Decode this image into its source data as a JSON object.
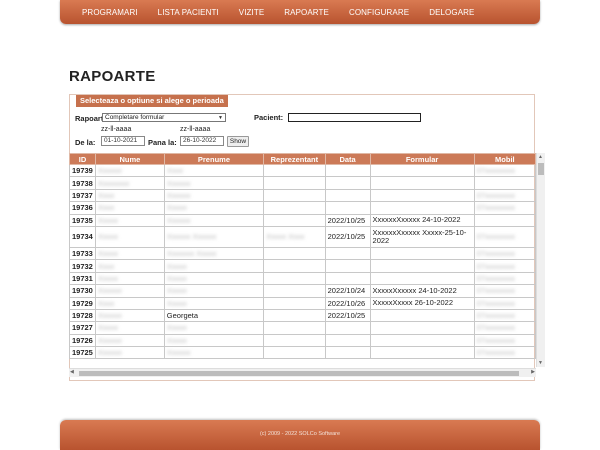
{
  "nav": [
    "PROGRAMARI",
    "LISTA PACIENTI",
    "VIZITE",
    "RAPOARTE",
    "CONFIGURARE",
    "DELOGARE"
  ],
  "page_title": "RAPOARTE",
  "filters": {
    "header": "Selecteaza o optiune si alege o perioada",
    "report_label": "Rapoarte:",
    "report_selected": "Completare formular",
    "patient_label": "Pacient:",
    "patient_value": "",
    "date_hint_from": "zz-ll-aaaa",
    "date_hint_to": "zz-ll-aaaa",
    "from_label": "De la:",
    "from_value": "01-10-2021",
    "to_label": "Pana la:",
    "to_value": "26-10-2022",
    "show_button": "Show"
  },
  "table": {
    "columns": [
      "ID",
      "Nume",
      "Prenume",
      "Reprezentant",
      "Data",
      "Formular",
      "Mobil"
    ],
    "rows": [
      {
        "id": "19739",
        "nume": "Xxxxxx",
        "prenume": "Xxxx",
        "rep": "",
        "data": "",
        "formular": "",
        "mobil": "07xxxxxxxx",
        "tall": false
      },
      {
        "id": "19738",
        "nume": "Xxxxxxxx",
        "prenume": "Xxxxxx",
        "rep": "",
        "data": "",
        "formular": "",
        "mobil": "",
        "tall": false
      },
      {
        "id": "19737",
        "nume": "Xxxx",
        "prenume": "Xxxxxx",
        "rep": "",
        "data": "",
        "formular": "",
        "mobil": "07xxxxxxxx",
        "tall": false
      },
      {
        "id": "19736",
        "nume": "Xxxx",
        "prenume": "Xxxxx",
        "rep": "",
        "data": "",
        "formular": "",
        "mobil": "07xxxxxxxx",
        "tall": false
      },
      {
        "id": "19735",
        "nume": "Xxxxx",
        "prenume": "Xxxxxx",
        "rep": "",
        "data": "2022/10/25",
        "formular": "XxxxxxXxxxxx 24-10-2022",
        "mobil": "",
        "tall": false
      },
      {
        "id": "19734",
        "nume": "Xxxxx",
        "prenume": "Xxxxxx Xxxxxx",
        "rep": "Xxxxx Xxxx",
        "data": "2022/10/25",
        "formular": "XxxxxxXxxxxx Xxxxx-25-10-2022",
        "mobil": "07xxxxxxxx",
        "tall": true
      },
      {
        "id": "19733",
        "nume": "Xxxxx",
        "prenume": "Xxxxxxx Xxxxx",
        "rep": "",
        "data": "",
        "formular": "",
        "mobil": "07xxxxxxxx",
        "tall": false
      },
      {
        "id": "19732",
        "nume": "Xxxx",
        "prenume": "Xxxxx",
        "rep": "",
        "data": "",
        "formular": "",
        "mobil": "07xxxxxxxx",
        "tall": false
      },
      {
        "id": "19731",
        "nume": "Xxxxx",
        "prenume": "Xxxxx",
        "rep": "",
        "data": "",
        "formular": "",
        "mobil": "07xxxxxxxx",
        "tall": false
      },
      {
        "id": "19730",
        "nume": "Xxxxxx",
        "prenume": "Xxxxx",
        "rep": "",
        "data": "2022/10/24",
        "formular": "XxxxxXxxxxx 24-10-2022",
        "mobil": "07xxxxxxxx",
        "tall": false
      },
      {
        "id": "19729",
        "nume": "Xxxx",
        "prenume": "Xxxxx",
        "rep": "",
        "data": "2022/10/26",
        "formular": "XxxxxXxxxx 26-10-2022",
        "mobil": "07xxxxxxxx",
        "tall": false
      },
      {
        "id": "19728",
        "nume": "Xxxxxx",
        "prenume": "Georgeta",
        "rep": "",
        "data": "2022/10/25",
        "formular": "",
        "mobil": "07xxxxxxxx",
        "tall": false
      },
      {
        "id": "19727",
        "nume": "Xxxxx",
        "prenume": "Xxxxx",
        "rep": "",
        "data": "",
        "formular": "",
        "mobil": "07xxxxxxxx",
        "tall": false
      },
      {
        "id": "19726",
        "nume": "Xxxxxx",
        "prenume": "Xxxxx",
        "rep": "",
        "data": "",
        "formular": "",
        "mobil": "07xxxxxxxx",
        "tall": false
      },
      {
        "id": "19725",
        "nume": "Xxxxxx",
        "prenume": "Xxxxxx",
        "rep": "",
        "data": "",
        "formular": "",
        "mobil": "07xxxxxxxx",
        "tall": false
      }
    ]
  },
  "footer": "(c) 2009 - 2022 SOLCo Software",
  "colors": {
    "accent": "#c6714d",
    "header_bg": "#cc7a58"
  }
}
